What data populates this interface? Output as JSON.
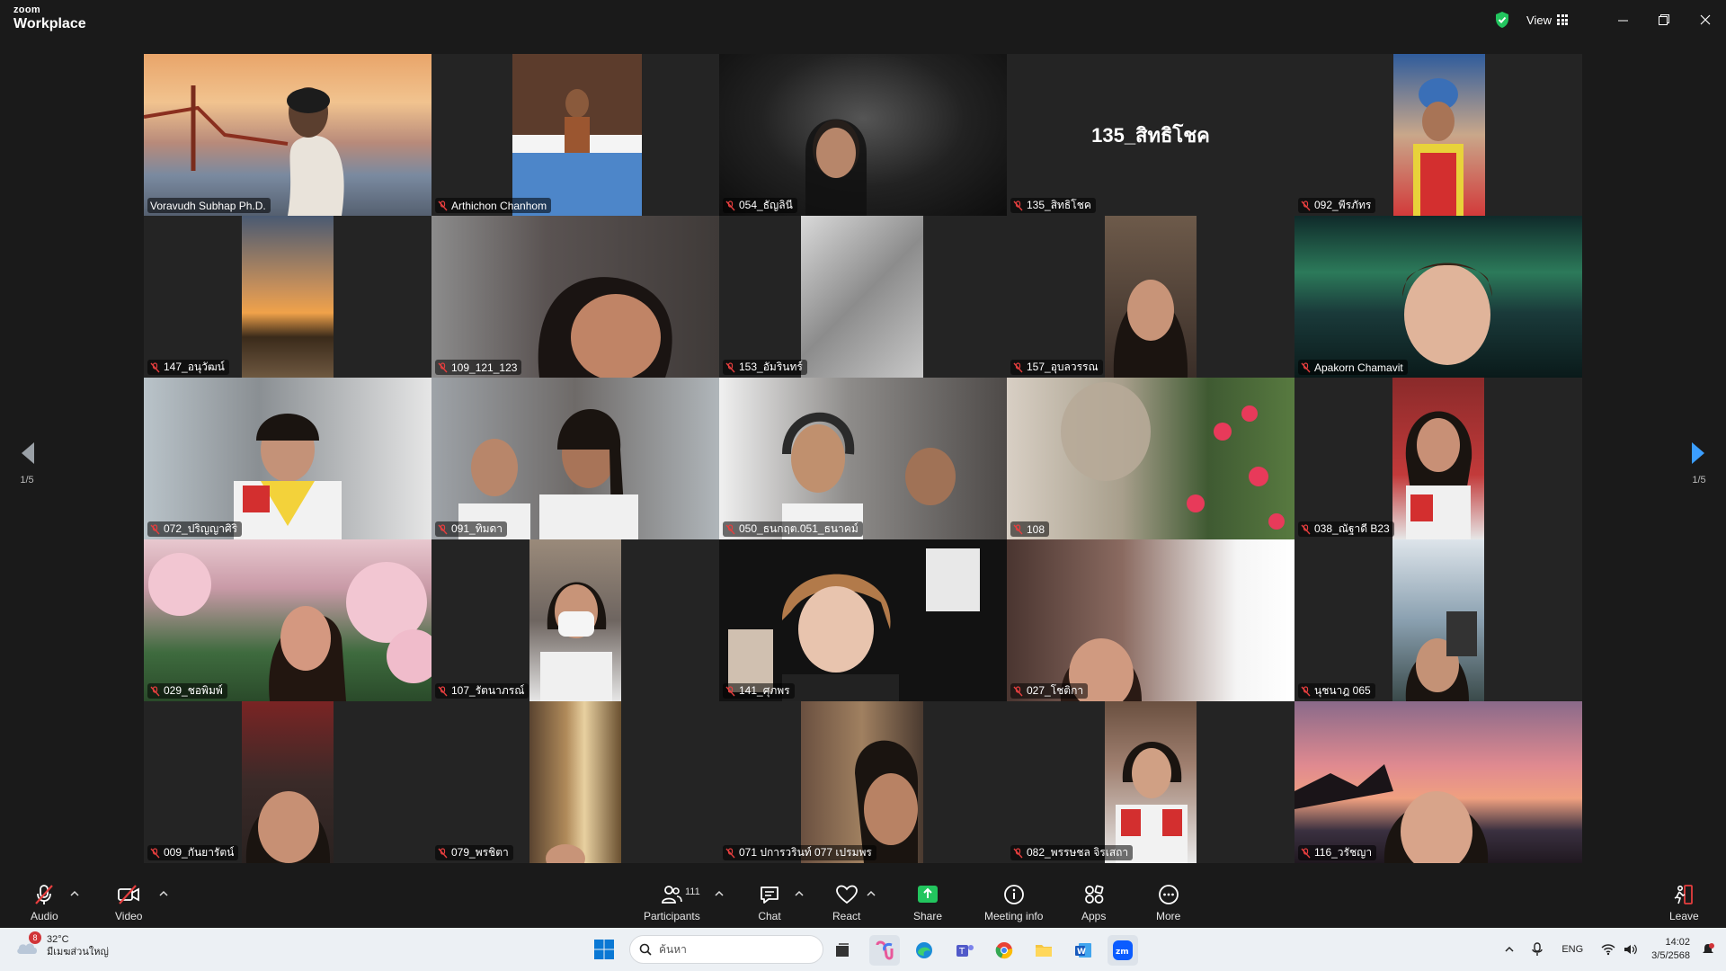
{
  "app": {
    "logo_line1": "zoom",
    "logo_line2": "Workplace",
    "view_label": "View"
  },
  "colors": {
    "active_speaker": "#2ee59d",
    "share_green": "#22c55e",
    "page_arrow": "#3b9eff",
    "mic_muted": "#e53e3e"
  },
  "page_indicator": {
    "left": "1/5",
    "right": "1/5"
  },
  "participants": [
    {
      "name": "Voravudh Subhap Ph.D.",
      "muted": false,
      "active": true
    },
    {
      "name": "Arthichon Chanhom",
      "muted": true
    },
    {
      "name": "054_ธัญลินี",
      "muted": true
    },
    {
      "name": "135_สิทธิโชค",
      "muted": true,
      "avatar_text": "135_สิทธิโชค"
    },
    {
      "name": "092_พีรภัทร",
      "muted": true
    },
    {
      "name": "147_อนุวัฒน์",
      "muted": true
    },
    {
      "name": "109_121_123",
      "muted": true
    },
    {
      "name": "153_อัมรินทร์",
      "muted": true
    },
    {
      "name": "157_อุบลวรรณ",
      "muted": true
    },
    {
      "name": "Apakorn Chamavit",
      "muted": true
    },
    {
      "name": "072_ปริญญาศิริ",
      "muted": true
    },
    {
      "name": "091_ทิมดา",
      "muted": true
    },
    {
      "name": "050_ธนกฤต.051_ธนาคม์",
      "muted": true
    },
    {
      "name": "108",
      "muted": true
    },
    {
      "name": "038_ณัฐาดี B23",
      "muted": true
    },
    {
      "name": "029_ชอพิมพ์",
      "muted": true
    },
    {
      "name": "107_รัตนาภรณ์",
      "muted": true
    },
    {
      "name": "141_ศุภพร",
      "muted": true
    },
    {
      "name": "027_โชติกา",
      "muted": true
    },
    {
      "name": "นุชนาฎ 065",
      "muted": true
    },
    {
      "name": "009_กันยารัตน์",
      "muted": true
    },
    {
      "name": "079_พรชิตา",
      "muted": true
    },
    {
      "name": "071 ปการวรินท์ 077 เปรมพร",
      "muted": true
    },
    {
      "name": "082_พรรษชล จิรเสถา",
      "muted": true
    },
    {
      "name": "116_วรัชญา",
      "muted": true
    }
  ],
  "toolbar": {
    "audio": "Audio",
    "video": "Video",
    "participants": "Participants",
    "participants_count": "111",
    "chat": "Chat",
    "react": "React",
    "share": "Share",
    "meeting_info": "Meeting info",
    "apps": "Apps",
    "more": "More",
    "leave": "Leave"
  },
  "taskbar": {
    "weather_badge": "8",
    "temperature": "32°C",
    "weather_desc": "มีเมฆส่วนใหญ่",
    "search_placeholder": "ค้นหา",
    "language": "ENG",
    "time": "14:02",
    "date": "3/5/2568"
  }
}
